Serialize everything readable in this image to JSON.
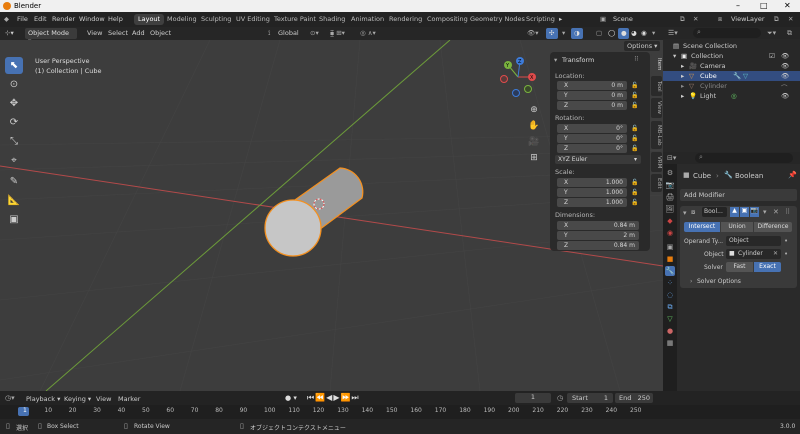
{
  "window": {
    "title": "Blender",
    "controls": [
      "–",
      "□",
      "✕"
    ]
  },
  "menu": [
    "File",
    "Edit",
    "Render",
    "Window",
    "Help"
  ],
  "workspaces": [
    "Layout",
    "Modeling",
    "Sculpting",
    "UV Editing",
    "Texture Paint",
    "Shading",
    "Animation",
    "Rendering",
    "Compositing",
    "Geometry Nodes",
    "Scripting"
  ],
  "scene": {
    "label": "Scene",
    "view_layer": "ViewLayer"
  },
  "viewport_header": {
    "mode": "Object Mode",
    "view": "View",
    "select": "Select",
    "add": "Add",
    "object": "Object",
    "transform": "Global",
    "options": "Options"
  },
  "viewport": {
    "perspective": "User Perspective",
    "collection": "(1) Collection | Cube"
  },
  "gizmo": {
    "x": "X",
    "y": "Y",
    "z": "Z"
  },
  "npanel": {
    "title": "Transform",
    "location_label": "Location:",
    "location": [
      {
        "k": "X",
        "v": "0 m"
      },
      {
        "k": "Y",
        "v": "0 m"
      },
      {
        "k": "Z",
        "v": "0 m"
      }
    ],
    "rotation_label": "Rotation:",
    "rotation": [
      {
        "k": "X",
        "v": "0°"
      },
      {
        "k": "Y",
        "v": "0°"
      },
      {
        "k": "Z",
        "v": "0°"
      }
    ],
    "rotation_mode": "XYZ Euler",
    "scale_label": "Scale:",
    "scale": [
      {
        "k": "X",
        "v": "1.000"
      },
      {
        "k": "Y",
        "v": "1.000"
      },
      {
        "k": "Z",
        "v": "1.000"
      }
    ],
    "dimensions_label": "Dimensions:",
    "dimensions": [
      {
        "k": "X",
        "v": "0.84 m"
      },
      {
        "k": "Y",
        "v": "2 m"
      },
      {
        "k": "Z",
        "v": "0.84 m"
      }
    ]
  },
  "side_tabs": [
    "Item",
    "Tool",
    "View",
    "MB-Lab",
    "VRM",
    "Edit"
  ],
  "outliner": {
    "root": "Scene Collection",
    "items": [
      "Collection",
      "Camera",
      "Cube",
      "Cylinder",
      "Light"
    ]
  },
  "properties": {
    "object": "Cube",
    "modifier_name": "Boolean",
    "add_modifier": "Add Modifier",
    "mod_short": "Bool...",
    "ops": [
      "Intersect",
      "Union",
      "Difference"
    ],
    "operand_label": "Operand Ty...",
    "operand_value": "Object",
    "object_label": "Object",
    "object_value": "Cylinder",
    "solver_label": "Solver",
    "solver_fast": "Fast",
    "solver_exact": "Exact",
    "solver_options": "Solver Options"
  },
  "timeline": {
    "playback": "Playback",
    "keying": "Keying",
    "view": "View",
    "marker": "Marker",
    "current": "1",
    "start_label": "Start",
    "start": "1",
    "end_label": "End",
    "end": "250",
    "frames": [
      "1",
      "10",
      "20",
      "30",
      "40",
      "50",
      "60",
      "70",
      "80",
      "90",
      "100",
      "110",
      "120",
      "130",
      "140",
      "150",
      "160",
      "170",
      "180",
      "190",
      "200",
      "210",
      "220",
      "230",
      "240",
      "250"
    ]
  },
  "status": {
    "select": "選択",
    "box": "Box Select",
    "rotate": "Rotate View",
    "context": "オブジェクトコンテクストメニュー",
    "version": "3.0.0"
  }
}
